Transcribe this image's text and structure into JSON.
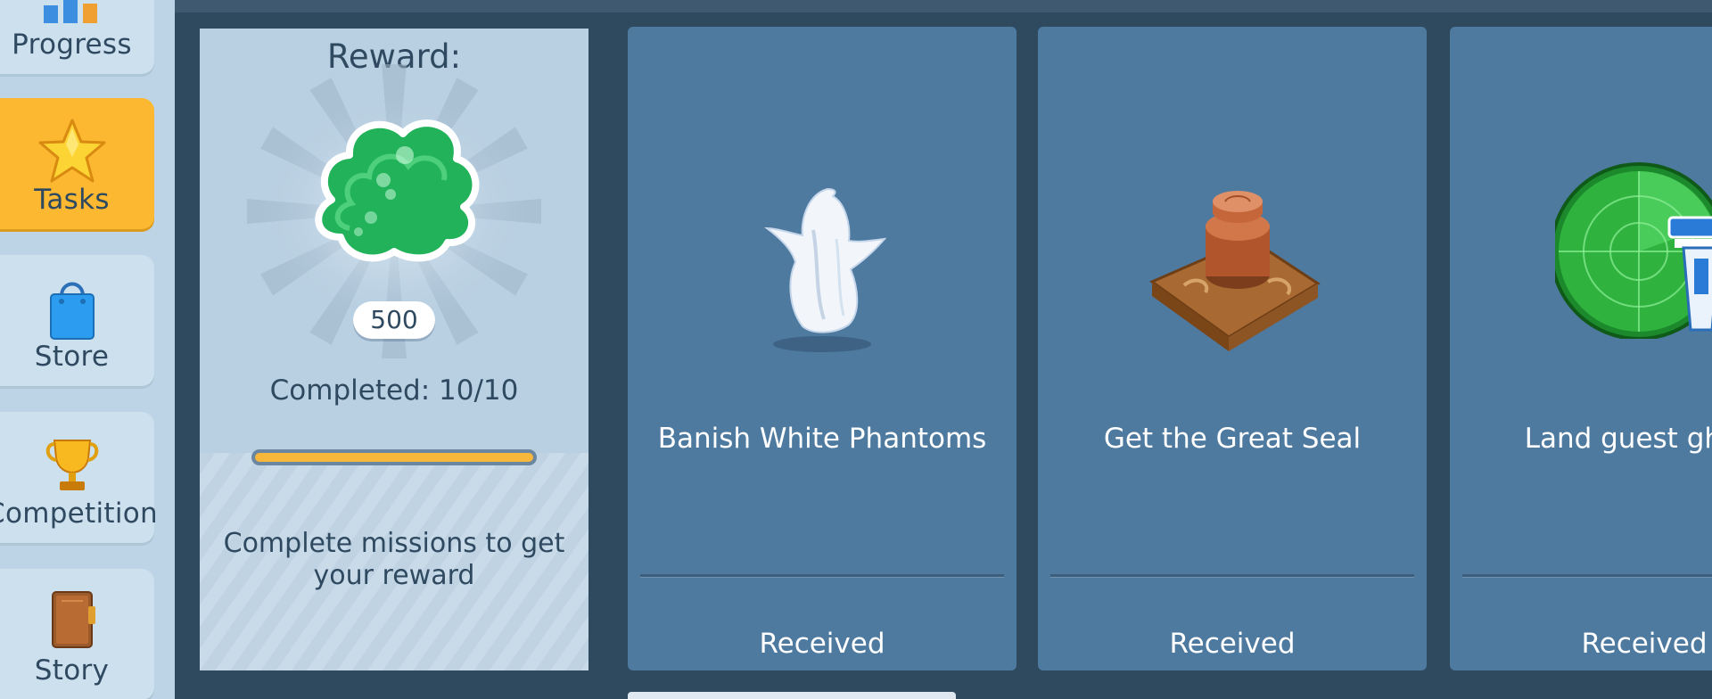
{
  "sidebar": {
    "items": [
      {
        "label": "Progress",
        "icon": "progress-chart-icon",
        "active": false
      },
      {
        "label": "Tasks",
        "icon": "star-icon",
        "active": true
      },
      {
        "label": "Store",
        "icon": "shopping-bag-icon",
        "active": false
      },
      {
        "label": "Competition",
        "icon": "trophy-icon",
        "active": false
      },
      {
        "label": "Story",
        "icon": "book-icon",
        "active": false
      }
    ]
  },
  "reward": {
    "title": "Reward:",
    "icon": "green-slime-icon",
    "amount": "500",
    "completed_label": "Completed: 10/10",
    "progress": 1.0,
    "hint": "Complete missions to get your reward"
  },
  "tasks": [
    {
      "title": "Banish White Phantoms",
      "icon": "white-phantom-icon",
      "status": "Received"
    },
    {
      "title": "Get the Great Seal",
      "icon": "great-seal-icon",
      "status": "Received"
    },
    {
      "title": "Land guest ghost",
      "icon": "radar-tower-icon",
      "status": "Received"
    }
  ],
  "colors": {
    "sidebar_bg": "#bcd4e6",
    "active_tab": "#fbb830",
    "card_bg": "#4e7aa0",
    "background": "#2f4a5f",
    "progress_fill": "#f6b73a"
  }
}
